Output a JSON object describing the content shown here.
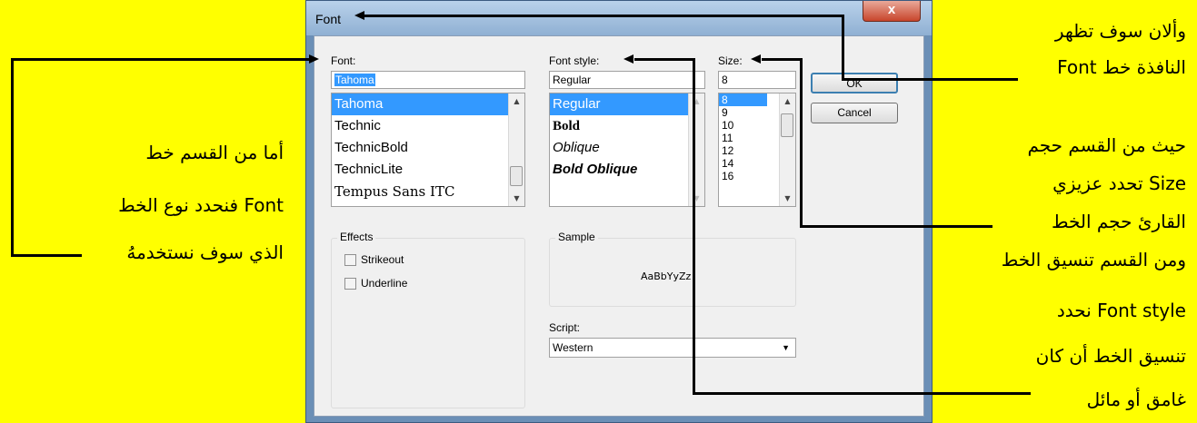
{
  "dialog": {
    "title": "Font",
    "close_glyph": "x",
    "font_label": "Font:",
    "font_value": "Tahoma",
    "fonts": [
      "Tahoma",
      "Technic",
      "TechnicBold",
      "TechnicLite",
      "Tempus Sans ITC"
    ],
    "style_label": "Font style:",
    "style_value": "Regular",
    "styles": [
      "Regular",
      "Bold",
      "Oblique",
      "Bold Oblique"
    ],
    "size_label": "Size:",
    "size_value": "8",
    "sizes": [
      "8",
      "9",
      "10",
      "11",
      "12",
      "14",
      "16"
    ],
    "ok_label": "OK",
    "cancel_label": "Cancel",
    "effects_label": "Effects",
    "strikeout_label": "Strikeout",
    "underline_label": "Underline",
    "sample_label": "Sample",
    "sample_text": "AaBbYyZz",
    "script_label": "Script:",
    "script_value": "Western"
  },
  "annotations": {
    "right": [
      "وألان سوف تظهر",
      "النافذة خط Font",
      "حيث من القسم حجم",
      "Size تحدد عزيزي",
      "القارئ حجم الخط",
      "ومن القسم تنسيق الخط",
      "Font style نحدد",
      "تنسيق الخط أن كان",
      "غامق أو مائل"
    ],
    "left": [
      "أما من القسم خط",
      "Font فنحدد نوع الخط",
      "الذي سوف نستخدمهُ"
    ]
  },
  "colors": {
    "background": "#ffff00",
    "selection": "#3399ff",
    "window_frame": "#6b8fb6",
    "close_button": "#c8452c"
  }
}
